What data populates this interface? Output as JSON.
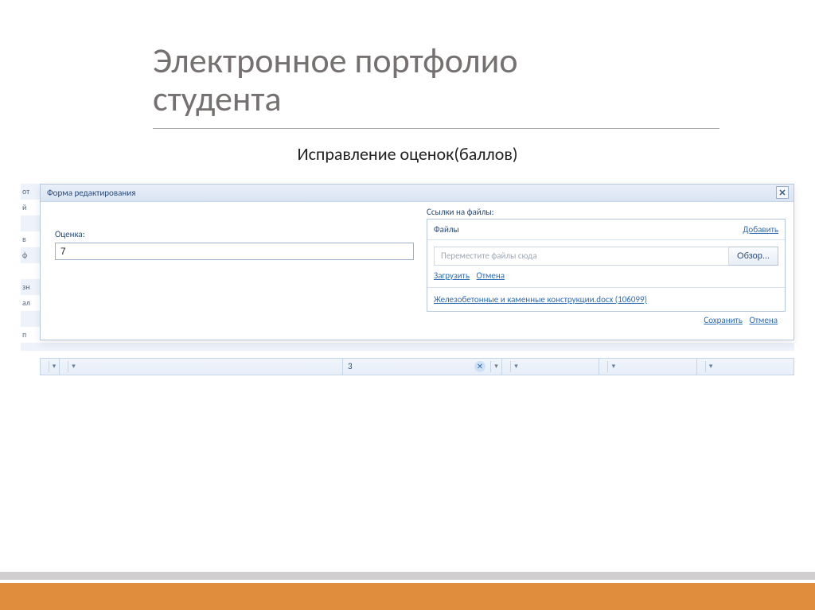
{
  "slide": {
    "title_line1": "Электронное портфолио",
    "title_line2": "студента",
    "subtitle": "Исправление оценок(баллов)"
  },
  "bg_labels": [
    "от",
    "й",
    "",
    "в",
    "ф",
    "",
    "зн",
    "ал",
    "",
    "п"
  ],
  "dialog": {
    "title": "Форма редактирования",
    "grade_label": "Оценка:",
    "grade_value": "7",
    "files_label": "Ссылки на файлы:",
    "files_header": "Файлы",
    "add_link": "Добавить",
    "drop_placeholder": "Переместите файлы сюда",
    "browse": "Обзор...",
    "upload": "Загрузить",
    "upload_cancel": "Отмена",
    "attachment": "Железобетонные и каменные конструкции.docx (106099)",
    "save": "Сохранить",
    "cancel": "Отмена"
  },
  "filter": {
    "value": "3"
  }
}
